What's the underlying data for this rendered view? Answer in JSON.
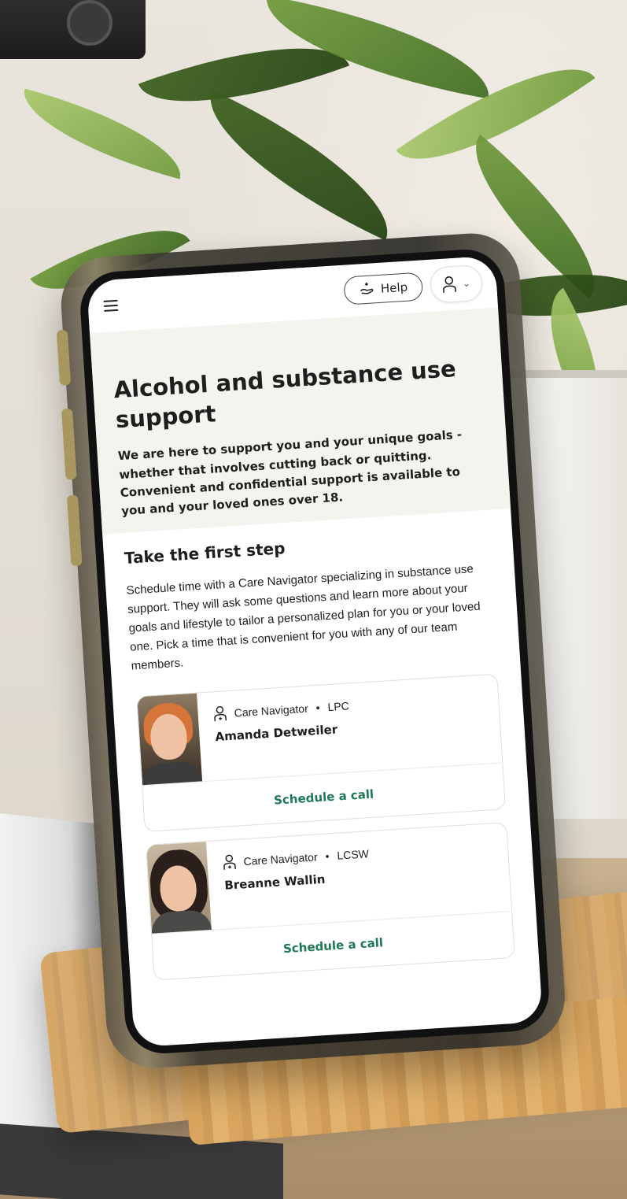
{
  "topbar": {
    "help_label": "Help"
  },
  "hero": {
    "title": "Alcohol and substance use support",
    "description": "We are here to support you and your unique goals - whether that involves cutting back or quitting. Convenient and confidential support is available to you and your loved ones over 18."
  },
  "first_step": {
    "heading": "Take the first step",
    "body": "Schedule time with a Care Navigator specializing in substance use support. They will ask some questions and learn more about your goals and lifestyle to tailor a personalized plan for you or your loved one. Pick a time that is convenient for you with any of our team members."
  },
  "navigators": [
    {
      "role": "Care Navigator",
      "credential": "LPC",
      "name": "Amanda Detweiler",
      "cta": "Schedule a call"
    },
    {
      "role": "Care Navigator",
      "credential": "LCSW",
      "name": "Breanne Wallin",
      "cta": "Schedule a call"
    }
  ],
  "separator": "•",
  "colors": {
    "accent": "#1c7a55",
    "hero_bg": "#f5f3ee",
    "text": "#1e1e1e"
  },
  "icons": {
    "menu": "hamburger-menu-icon",
    "help": "hand-heart-icon",
    "account": "person-icon",
    "dropdown": "chevron-down-icon",
    "navigator": "care-navigator-icon"
  }
}
